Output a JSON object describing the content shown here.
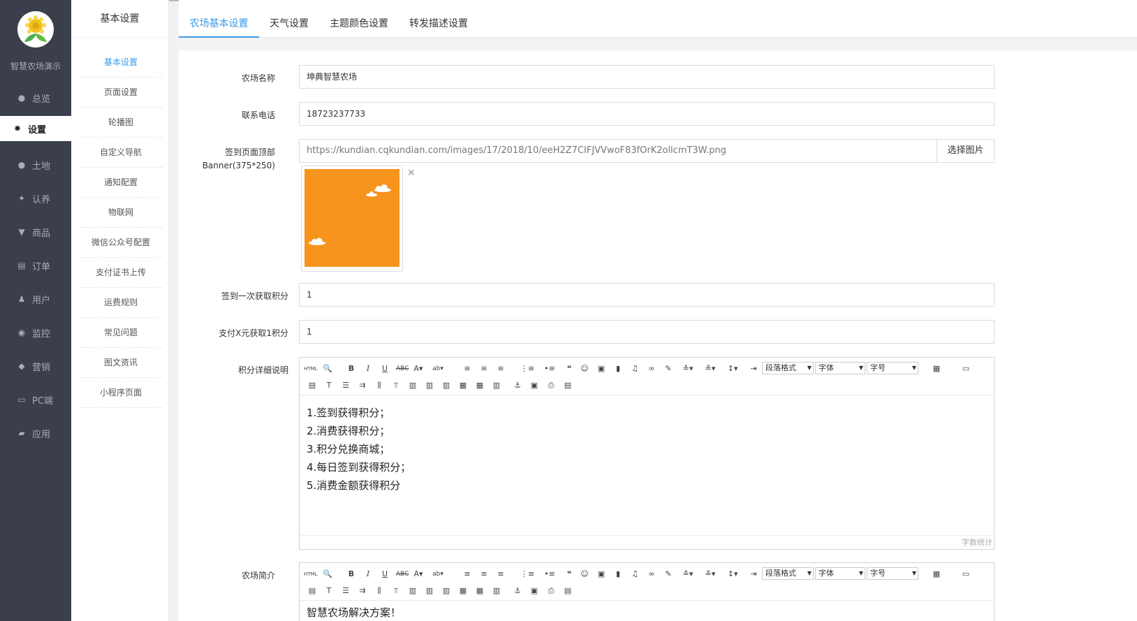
{
  "app": {
    "brand_name": "智慧农场演示",
    "icons": {
      "logo": "sunflower-logo"
    }
  },
  "nav": {
    "items": [
      {
        "label": "总览",
        "icon": "globe-icon"
      },
      {
        "label": "设置",
        "icon": "gear-icon"
      },
      {
        "label": "土地",
        "icon": "globe-icon"
      },
      {
        "label": "认养",
        "icon": "twitter-bird-icon"
      },
      {
        "label": "商品",
        "icon": "cart-icon"
      },
      {
        "label": "订单",
        "icon": "card-icon"
      },
      {
        "label": "用户",
        "icon": "user-icon"
      },
      {
        "label": "监控",
        "icon": "play-circle-icon"
      },
      {
        "label": "营销",
        "icon": "tag-icon"
      },
      {
        "label": "PC端",
        "icon": "monitor-icon"
      },
      {
        "label": "应用",
        "icon": "book-icon"
      }
    ]
  },
  "subnav": {
    "title": "基本设置",
    "items": [
      "基本设置",
      "页面设置",
      "轮播图",
      "自定义导航",
      "通知配置",
      "物联网",
      "微信公众号配置",
      "支付证书上传",
      "运费规则",
      "常见问题",
      "图文资讯",
      "小程序页面"
    ]
  },
  "tabs": [
    "农场基本设置",
    "天气设置",
    "主题颜色设置",
    "转发描述设置"
  ],
  "form": {
    "farm_name_label": "农场名称",
    "farm_name_value": "坤典智慧农场",
    "phone_label": "联系电话",
    "phone_value": "18723237733",
    "banner_label_line1": "签到页面顶部",
    "banner_label_line2": "Banner(375*250)",
    "banner_url": "https://kundian.cqkundian.com/images/17/2018/10/eeH2Z7CIFJVVwoF83fOrK2ollcmT3W.png",
    "select_image_button": "选择图片",
    "banner_color": "#f7941d",
    "sign_points_label": "签到一次获取积分",
    "sign_points_value": "1",
    "pay_points_label": "支付X元获取1积分",
    "pay_points_value": "1",
    "points_desc_label": "积分详细说明",
    "points_desc_lines": [
      "1.签到获得积分；",
      "2.消费获得积分；",
      "3.积分兑换商城；",
      "4.每日签到获得积分；",
      "5.消费金额获得积分"
    ],
    "word_count_label": "字数统计",
    "farm_intro_label": "农场简介",
    "farm_intro_first_line": "智慧农场解决方案！"
  },
  "editor_toolbar": {
    "paragraph_format": "段落格式",
    "font_family": "字体",
    "font_size": "字号"
  },
  "colors": {
    "accent": "#3a9ae8",
    "sidebar_bg": "#3b3f4c"
  }
}
